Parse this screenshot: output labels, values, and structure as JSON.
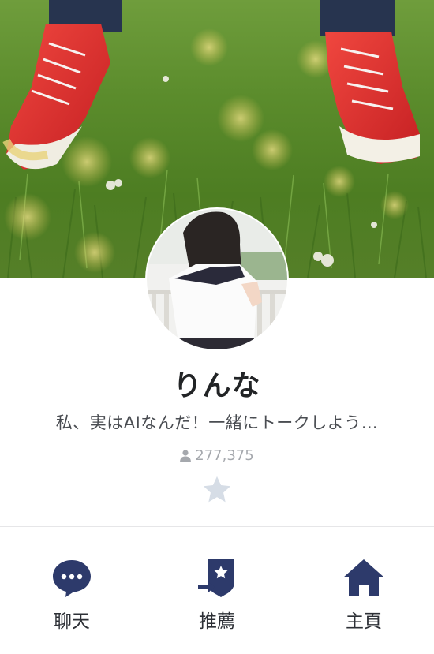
{
  "profile": {
    "name": "りんな",
    "status_message": "私、実はAIなんだ！一緒にトークしよう…",
    "follower_count": "277,375"
  },
  "actions": {
    "chat_label": "聊天",
    "recommend_label": "推薦",
    "home_label": "主頁"
  },
  "colors": {
    "accent_navy": "#2d3a6b",
    "star_inactive": "#d6dde6",
    "text_dark": "#222426",
    "text_muted": "#a5a8ad"
  },
  "icons": {
    "chat": "chat-bubble-icon",
    "recommend": "share-star-icon",
    "home": "home-icon",
    "favorite": "star-icon",
    "followers": "person-icon"
  }
}
